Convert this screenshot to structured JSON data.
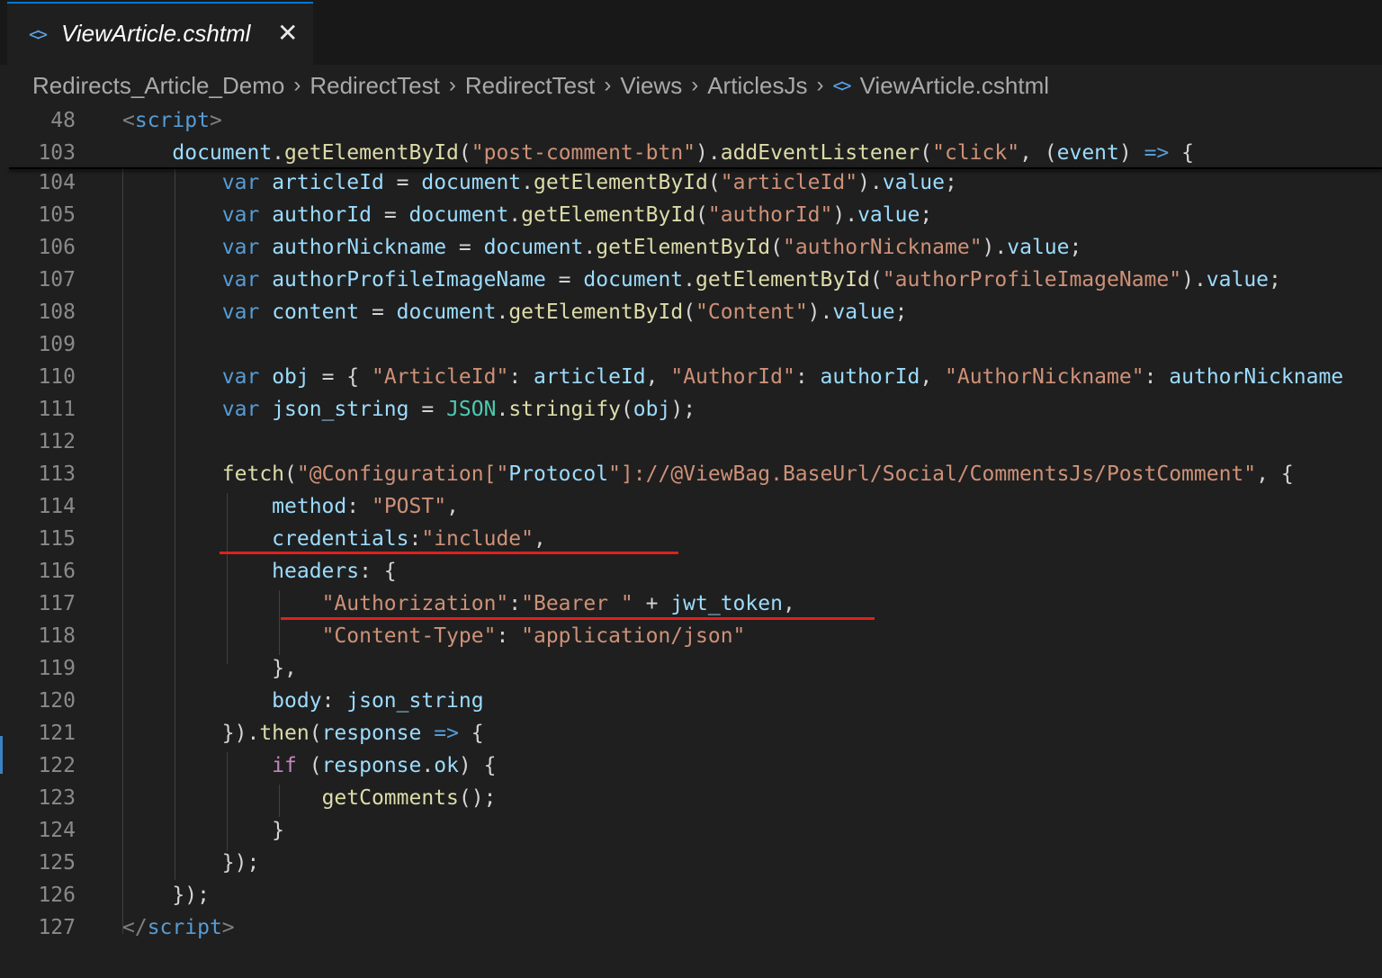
{
  "tab": {
    "icon": "code-file-icon",
    "label": "ViewArticle.cshtml",
    "close": "✕"
  },
  "breadcrumb": {
    "items": [
      "Redirects_Article_Demo",
      "RedirectTest",
      "RedirectTest",
      "Views",
      "ArticlesJs"
    ],
    "file_icon": "code-file-icon",
    "file": "ViewArticle.cshtml",
    "separator": "›"
  },
  "colors": {
    "background": "#1f1f1f",
    "tab_accent": "#0078d4",
    "annotation_underline": "#e0211d",
    "string": "#ce9178",
    "variable": "#9cdcfe",
    "function": "#dcdcaa",
    "keyword": "#569cd6"
  },
  "editor": {
    "sticky_lines": [
      {
        "num": "48",
        "segments": [
          [
            "t-punc",
            "<"
          ],
          [
            "t-tag",
            "script"
          ],
          [
            "t-punc",
            ">"
          ]
        ]
      },
      {
        "num": "103",
        "segments": [
          [
            "t-op",
            "    "
          ],
          [
            "t-var",
            "document"
          ],
          [
            "t-op",
            "."
          ],
          [
            "t-fn",
            "getElementById"
          ],
          [
            "t-op",
            "("
          ],
          [
            "t-str",
            "\"post-comment-btn\""
          ],
          [
            "t-op",
            ")."
          ],
          [
            "t-fn",
            "addEventListener"
          ],
          [
            "t-op",
            "("
          ],
          [
            "t-str",
            "\"click\""
          ],
          [
            "t-op",
            ", ("
          ],
          [
            "t-var",
            "event"
          ],
          [
            "t-op",
            ") "
          ],
          [
            "t-kw",
            "=>"
          ],
          [
            "t-op",
            " {"
          ]
        ]
      }
    ],
    "lines": [
      {
        "num": "104",
        "segments": [
          [
            "t-op",
            "        "
          ],
          [
            "t-kw",
            "var"
          ],
          [
            "t-op",
            " "
          ],
          [
            "t-var",
            "articleId"
          ],
          [
            "t-op",
            " = "
          ],
          [
            "t-var",
            "document"
          ],
          [
            "t-op",
            "."
          ],
          [
            "t-fn",
            "getElementById"
          ],
          [
            "t-op",
            "("
          ],
          [
            "t-str",
            "\"articleId\""
          ],
          [
            "t-op",
            ")."
          ],
          [
            "t-var",
            "value"
          ],
          [
            "t-op",
            ";"
          ]
        ]
      },
      {
        "num": "105",
        "segments": [
          [
            "t-op",
            "        "
          ],
          [
            "t-kw",
            "var"
          ],
          [
            "t-op",
            " "
          ],
          [
            "t-var",
            "authorId"
          ],
          [
            "t-op",
            " = "
          ],
          [
            "t-var",
            "document"
          ],
          [
            "t-op",
            "."
          ],
          [
            "t-fn",
            "getElementById"
          ],
          [
            "t-op",
            "("
          ],
          [
            "t-str",
            "\"authorId\""
          ],
          [
            "t-op",
            ")."
          ],
          [
            "t-var",
            "value"
          ],
          [
            "t-op",
            ";"
          ]
        ]
      },
      {
        "num": "106",
        "segments": [
          [
            "t-op",
            "        "
          ],
          [
            "t-kw",
            "var"
          ],
          [
            "t-op",
            " "
          ],
          [
            "t-var",
            "authorNickname"
          ],
          [
            "t-op",
            " = "
          ],
          [
            "t-var",
            "document"
          ],
          [
            "t-op",
            "."
          ],
          [
            "t-fn",
            "getElementById"
          ],
          [
            "t-op",
            "("
          ],
          [
            "t-str",
            "\"authorNickname\""
          ],
          [
            "t-op",
            ")."
          ],
          [
            "t-var",
            "value"
          ],
          [
            "t-op",
            ";"
          ]
        ]
      },
      {
        "num": "107",
        "segments": [
          [
            "t-op",
            "        "
          ],
          [
            "t-kw",
            "var"
          ],
          [
            "t-op",
            " "
          ],
          [
            "t-var",
            "authorProfileImageName"
          ],
          [
            "t-op",
            " = "
          ],
          [
            "t-var",
            "document"
          ],
          [
            "t-op",
            "."
          ],
          [
            "t-fn",
            "getElementById"
          ],
          [
            "t-op",
            "("
          ],
          [
            "t-str",
            "\"authorProfileImageName\""
          ],
          [
            "t-op",
            ")."
          ],
          [
            "t-var",
            "value"
          ],
          [
            "t-op",
            ";"
          ]
        ]
      },
      {
        "num": "108",
        "segments": [
          [
            "t-op",
            "        "
          ],
          [
            "t-kw",
            "var"
          ],
          [
            "t-op",
            " "
          ],
          [
            "t-var",
            "content"
          ],
          [
            "t-op",
            " = "
          ],
          [
            "t-var",
            "document"
          ],
          [
            "t-op",
            "."
          ],
          [
            "t-fn",
            "getElementById"
          ],
          [
            "t-op",
            "("
          ],
          [
            "t-str",
            "\"Content\""
          ],
          [
            "t-op",
            ")."
          ],
          [
            "t-var",
            "value"
          ],
          [
            "t-op",
            ";"
          ]
        ]
      },
      {
        "num": "109",
        "segments": []
      },
      {
        "num": "110",
        "segments": [
          [
            "t-op",
            "        "
          ],
          [
            "t-kw",
            "var"
          ],
          [
            "t-op",
            " "
          ],
          [
            "t-var",
            "obj"
          ],
          [
            "t-op",
            " = { "
          ],
          [
            "t-str",
            "\"ArticleId\""
          ],
          [
            "t-op",
            ": "
          ],
          [
            "t-var",
            "articleId"
          ],
          [
            "t-op",
            ", "
          ],
          [
            "t-str",
            "\"AuthorId\""
          ],
          [
            "t-op",
            ": "
          ],
          [
            "t-var",
            "authorId"
          ],
          [
            "t-op",
            ", "
          ],
          [
            "t-str",
            "\"AuthorNickname\""
          ],
          [
            "t-op",
            ": "
          ],
          [
            "t-var",
            "authorNickname"
          ]
        ]
      },
      {
        "num": "111",
        "segments": [
          [
            "t-op",
            "        "
          ],
          [
            "t-kw",
            "var"
          ],
          [
            "t-op",
            " "
          ],
          [
            "t-var",
            "json_string"
          ],
          [
            "t-op",
            " = "
          ],
          [
            "t-cls",
            "JSON"
          ],
          [
            "t-op",
            "."
          ],
          [
            "t-fn",
            "stringify"
          ],
          [
            "t-op",
            "("
          ],
          [
            "t-var",
            "obj"
          ],
          [
            "t-op",
            ");"
          ]
        ]
      },
      {
        "num": "112",
        "segments": []
      },
      {
        "num": "113",
        "segments": [
          [
            "t-op",
            "        "
          ],
          [
            "t-fn",
            "fetch"
          ],
          [
            "t-op",
            "("
          ],
          [
            "t-str",
            "\"@Configuration[\""
          ],
          [
            "t-var",
            "Protocol"
          ],
          [
            "t-str",
            "\"]://@ViewBag.BaseUrl/Social/CommentsJs/PostComment\""
          ],
          [
            "t-op",
            ", {"
          ]
        ]
      },
      {
        "num": "114",
        "segments": [
          [
            "t-op",
            "            "
          ],
          [
            "t-var",
            "method"
          ],
          [
            "t-op",
            ": "
          ],
          [
            "t-str",
            "\"POST\""
          ],
          [
            "t-op",
            ","
          ]
        ]
      },
      {
        "num": "115",
        "segments": [
          [
            "t-op",
            "            "
          ],
          [
            "t-var",
            "credentials"
          ],
          [
            "t-op",
            ":"
          ],
          [
            "t-str",
            "\"include\""
          ],
          [
            "t-op",
            ","
          ]
        ]
      },
      {
        "num": "116",
        "segments": [
          [
            "t-op",
            "            "
          ],
          [
            "t-var",
            "headers"
          ],
          [
            "t-op",
            ": {"
          ]
        ]
      },
      {
        "num": "117",
        "segments": [
          [
            "t-op",
            "                "
          ],
          [
            "t-str",
            "\"Authorization\""
          ],
          [
            "t-op",
            ":"
          ],
          [
            "t-str",
            "\"Bearer \""
          ],
          [
            "t-op",
            " + "
          ],
          [
            "t-var",
            "jwt_token"
          ],
          [
            "t-op",
            ","
          ]
        ]
      },
      {
        "num": "118",
        "segments": [
          [
            "t-op",
            "                "
          ],
          [
            "t-str",
            "\"Content-Type\""
          ],
          [
            "t-op",
            ": "
          ],
          [
            "t-str",
            "\"application/json\""
          ]
        ]
      },
      {
        "num": "119",
        "segments": [
          [
            "t-op",
            "            },"
          ]
        ]
      },
      {
        "num": "120",
        "segments": [
          [
            "t-op",
            "            "
          ],
          [
            "t-var",
            "body"
          ],
          [
            "t-op",
            ": "
          ],
          [
            "t-var",
            "json_string"
          ]
        ]
      },
      {
        "num": "121",
        "segments": [
          [
            "t-op",
            "        })."
          ],
          [
            "t-fn",
            "then"
          ],
          [
            "t-op",
            "("
          ],
          [
            "t-var",
            "response"
          ],
          [
            "t-op",
            " "
          ],
          [
            "t-kw",
            "=>"
          ],
          [
            "t-op",
            " {"
          ]
        ]
      },
      {
        "num": "122",
        "segments": [
          [
            "t-op",
            "            "
          ],
          [
            "t-ctl",
            "if"
          ],
          [
            "t-op",
            " ("
          ],
          [
            "t-var",
            "response"
          ],
          [
            "t-op",
            "."
          ],
          [
            "t-var",
            "ok"
          ],
          [
            "t-op",
            ") {"
          ]
        ]
      },
      {
        "num": "123",
        "segments": [
          [
            "t-op",
            "                "
          ],
          [
            "t-fn",
            "getComments"
          ],
          [
            "t-op",
            "();"
          ]
        ]
      },
      {
        "num": "124",
        "segments": [
          [
            "t-op",
            "            }"
          ]
        ]
      },
      {
        "num": "125",
        "segments": [
          [
            "t-op",
            "        });"
          ]
        ]
      },
      {
        "num": "126",
        "segments": [
          [
            "t-op",
            "    });"
          ]
        ]
      },
      {
        "num": "127",
        "segments": [
          [
            "t-punc",
            "</"
          ],
          [
            "t-tag",
            "script"
          ],
          [
            "t-punc",
            ">"
          ]
        ]
      }
    ]
  }
}
